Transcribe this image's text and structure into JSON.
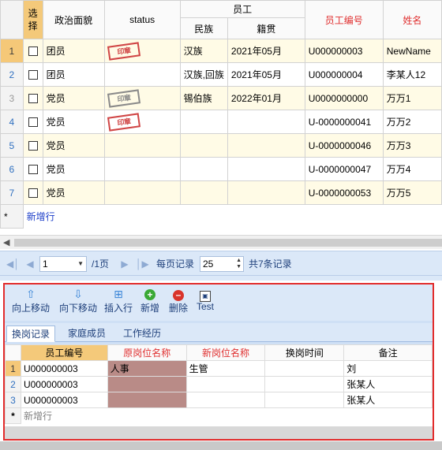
{
  "main_grid": {
    "headers": {
      "select": "选择",
      "political": "政治面貌",
      "status": "status",
      "employee_group": "员工",
      "ethnicity": "民族",
      "native_place": "籍贯",
      "employee_id": "员工编号",
      "name": "姓名"
    },
    "rows": [
      {
        "num": "1",
        "political": "团员",
        "status": "stamp-red",
        "ethnicity": "汉族",
        "native": "2021年05月",
        "emp_id": "U000000003",
        "name": "NewName"
      },
      {
        "num": "2",
        "political": "团员",
        "status": "",
        "ethnicity": "汉族,回族",
        "native": "2021年05月",
        "emp_id": "U000000004",
        "name": "李某人12"
      },
      {
        "num": "3",
        "political": "党员",
        "status": "stamp-gray",
        "ethnicity": "锡伯族",
        "native": "2022年01月",
        "emp_id": "U0000000000",
        "name": "万万1"
      },
      {
        "num": "4",
        "political": "党员",
        "status": "stamp-red",
        "ethnicity": "",
        "native": "",
        "emp_id": "U-0000000041",
        "name": "万万2"
      },
      {
        "num": "5",
        "political": "党员",
        "status": "",
        "ethnicity": "",
        "native": "",
        "emp_id": "U-0000000046",
        "name": "万万3"
      },
      {
        "num": "6",
        "political": "党员",
        "status": "",
        "ethnicity": "",
        "native": "",
        "emp_id": "U-0000000047",
        "name": "万万4"
      },
      {
        "num": "7",
        "political": "党员",
        "status": "",
        "ethnicity": "",
        "native": "",
        "emp_id": "U-0000000053",
        "name": "万万5"
      }
    ],
    "new_row_marker": "*",
    "new_row_label": "新增行"
  },
  "pager": {
    "current_page": "1",
    "total_pages": "/1页",
    "page_size_label": "每页记录",
    "page_size": "25",
    "total_records": "共7条记录"
  },
  "toolbar": {
    "move_up": "向上移动",
    "move_down": "向下移动",
    "insert_row": "插入行",
    "add": "新增",
    "delete": "删除",
    "test": "Test"
  },
  "tabs": [
    "换岗记录",
    "家庭成员",
    "工作经历"
  ],
  "sub_grid": {
    "headers": {
      "employee_id": "员工编号",
      "old_position": "原岗位名称",
      "new_position": "新岗位名称",
      "change_time": "换岗时间",
      "remarks": "备注"
    },
    "rows": [
      {
        "num": "1",
        "emp_id": "U000000003",
        "old": "人事",
        "new": "生管",
        "time": "",
        "remark": "刘"
      },
      {
        "num": "2",
        "emp_id": "U000000003",
        "old": "",
        "new": "",
        "time": "",
        "remark": "张某人"
      },
      {
        "num": "3",
        "emp_id": "U000000003",
        "old": "",
        "new": "",
        "time": "",
        "remark": "张某人"
      }
    ],
    "new_row_marker": "*",
    "new_row_label": "新增行"
  },
  "colors": {
    "selection_orange": "#f4c97a",
    "highlight_red": "#e22c2c",
    "rose_cell": "#b98b87",
    "pager_blue": "#dbe8f8"
  },
  "icons": {
    "first_page": "first-page-icon",
    "prev_page": "prev-page-icon",
    "next_page": "next-page-icon",
    "last_page": "last-page-icon",
    "stamp": "stamp-icon"
  }
}
